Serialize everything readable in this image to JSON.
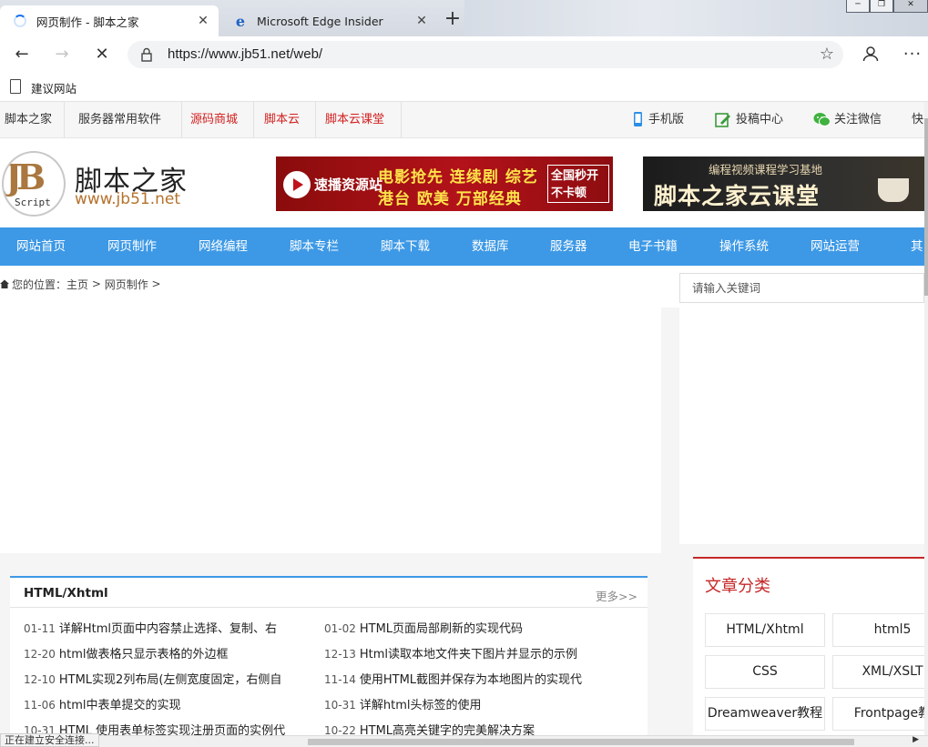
{
  "browser": {
    "tabs": [
      {
        "label": "网页制作 - 脚本之家",
        "state": "loading",
        "active": true
      },
      {
        "label": "Microsoft Edge Insider",
        "icon": "edge-icon",
        "active": false
      }
    ],
    "url": "https://www.jb51.net/web/",
    "favorites": [
      {
        "label": "建议网站"
      }
    ],
    "status": "正在建立安全连接..."
  },
  "site": {
    "topnav": {
      "left": [
        {
          "label": "脚本之家",
          "red": false
        },
        {
          "label": "服务器常用软件",
          "red": false
        },
        {
          "label": "源码商城",
          "red": true
        },
        {
          "label": "脚本云",
          "red": true
        },
        {
          "label": "脚本云课堂",
          "red": true
        }
      ],
      "right": [
        {
          "label": "手机版",
          "icon": "phone-icon"
        },
        {
          "label": "投稿中心",
          "icon": "edit-icon"
        },
        {
          "label": "关注微信",
          "icon": "wechat-icon"
        },
        {
          "label": "快"
        }
      ]
    },
    "logo": {
      "mark": "JB",
      "mark_sub": "Script",
      "name_cn": "脚本之家",
      "name_en": "www.jb51.net"
    },
    "ad1": {
      "site": "速播资源站",
      "line1": "电影抢先 连续剧 综艺",
      "line2": "港台 欧美  万部经典",
      "box_line1": "全国秒开",
      "box_line2": "不卡顿"
    },
    "ad2": {
      "line1": "编程视频课程学习基地",
      "line2": "脚本之家云课堂"
    },
    "mainnav": [
      "网站首页",
      "网页制作",
      "网络编程",
      "脚本专栏",
      "脚本下载",
      "数据库",
      "服务器",
      "电子书籍",
      "操作系统",
      "网站运营",
      "其"
    ],
    "breadcrumb": {
      "prefix": "您的位置：",
      "home": "主页",
      "sep1": " > ",
      "section": "网页制作",
      "sep2": " >"
    },
    "search": {
      "placeholder": "请输入关键词"
    },
    "articles": {
      "title": "HTML/Xhtml",
      "more": "更多>>",
      "items": [
        {
          "date": "01-11",
          "title": "详解Html页面中内容禁止选择、复制、右"
        },
        {
          "date": "01-02",
          "title": "HTML页面局部刷新的实现代码"
        },
        {
          "date": "12-20",
          "title": "html做表格只显示表格的外边框"
        },
        {
          "date": "12-13",
          "title": "Html读取本地文件夹下图片并显示的示例"
        },
        {
          "date": "12-10",
          "title": "HTML实现2列布局(左侧宽度固定，右侧自"
        },
        {
          "date": "11-14",
          "title": "使用HTML截图并保存为本地图片的实现代"
        },
        {
          "date": "11-06",
          "title": "html中表单提交的实现"
        },
        {
          "date": "10-31",
          "title": "详解html头标签的使用"
        },
        {
          "date": "10-31",
          "title": "HTML 使用表单标签实现注册页面的实例代"
        },
        {
          "date": "10-22",
          "title": "HTML高亮关键字的完美解决方案"
        }
      ]
    },
    "categories": {
      "title": "文章分类",
      "items": [
        "HTML/Xhtml",
        "html5",
        "CSS",
        "XML/XSLT",
        "Dreamweaver教程",
        "Frontpage教"
      ]
    }
  }
}
